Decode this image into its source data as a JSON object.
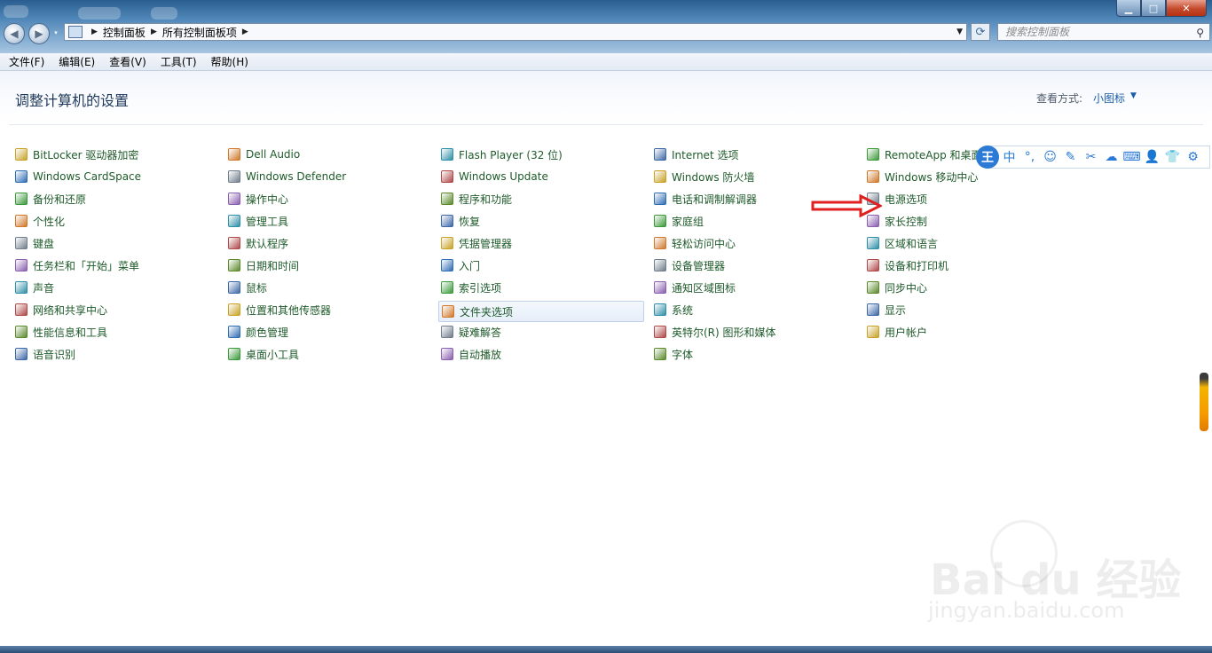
{
  "window": {
    "min_glyph": "▁",
    "max_glyph": "□",
    "close_glyph": "✕"
  },
  "nav": {
    "back_glyph": "◀",
    "forward_glyph": "▶"
  },
  "address": {
    "crumbs": [
      "控制面板",
      "所有控制面板项"
    ],
    "sep": "▶"
  },
  "search": {
    "placeholder": "搜索控制面板"
  },
  "menu": {
    "items": [
      "文件(F)",
      "编辑(E)",
      "查看(V)",
      "工具(T)",
      "帮助(H)"
    ]
  },
  "header": {
    "title": "调整计算机的设置",
    "view_by_label": "查看方式:",
    "view_by_value": "小图标"
  },
  "columns": [
    [
      "BitLocker 驱动器加密",
      "Windows CardSpace",
      "备份和还原",
      "个性化",
      "键盘",
      "任务栏和「开始」菜单",
      "声音",
      "网络和共享中心",
      "性能信息和工具",
      "语音识别"
    ],
    [
      "Dell Audio",
      "Windows Defender",
      "操作中心",
      "管理工具",
      "默认程序",
      "日期和时间",
      "鼠标",
      "位置和其他传感器",
      "颜色管理",
      "桌面小工具"
    ],
    [
      "Flash Player (32 位)",
      "Windows Update",
      "程序和功能",
      "恢复",
      "凭据管理器",
      "入门",
      "索引选项",
      "文件夹选项",
      "疑难解答",
      "自动播放"
    ],
    [
      "Internet 选项",
      "Windows 防火墙",
      "电话和调制解调器",
      "家庭组",
      "轻松访问中心",
      "设备管理器",
      "通知区域图标",
      "系统",
      "英特尔(R) 图形和媒体",
      "字体"
    ],
    [
      "RemoteApp 和桌面",
      "Windows 移动中心",
      "电源选项",
      "家长控制",
      "区域和语言",
      "设备和打印机",
      "同步中心",
      "显示",
      "用户帐户"
    ]
  ],
  "selected_item": "文件夹选项",
  "ime": {
    "logo": "王",
    "buttons": [
      "中",
      "°,",
      "☺",
      "✎",
      "✂",
      "☁",
      "⌨",
      "👤",
      "👕",
      "⚙"
    ]
  },
  "watermark": {
    "main": "Bai du 经验",
    "sub": "jingyan.baidu.com"
  },
  "colors": {
    "link": "#1e5a2a",
    "title": "#1e395b",
    "accent": "#1b5eab",
    "arrow": "#e02020"
  }
}
